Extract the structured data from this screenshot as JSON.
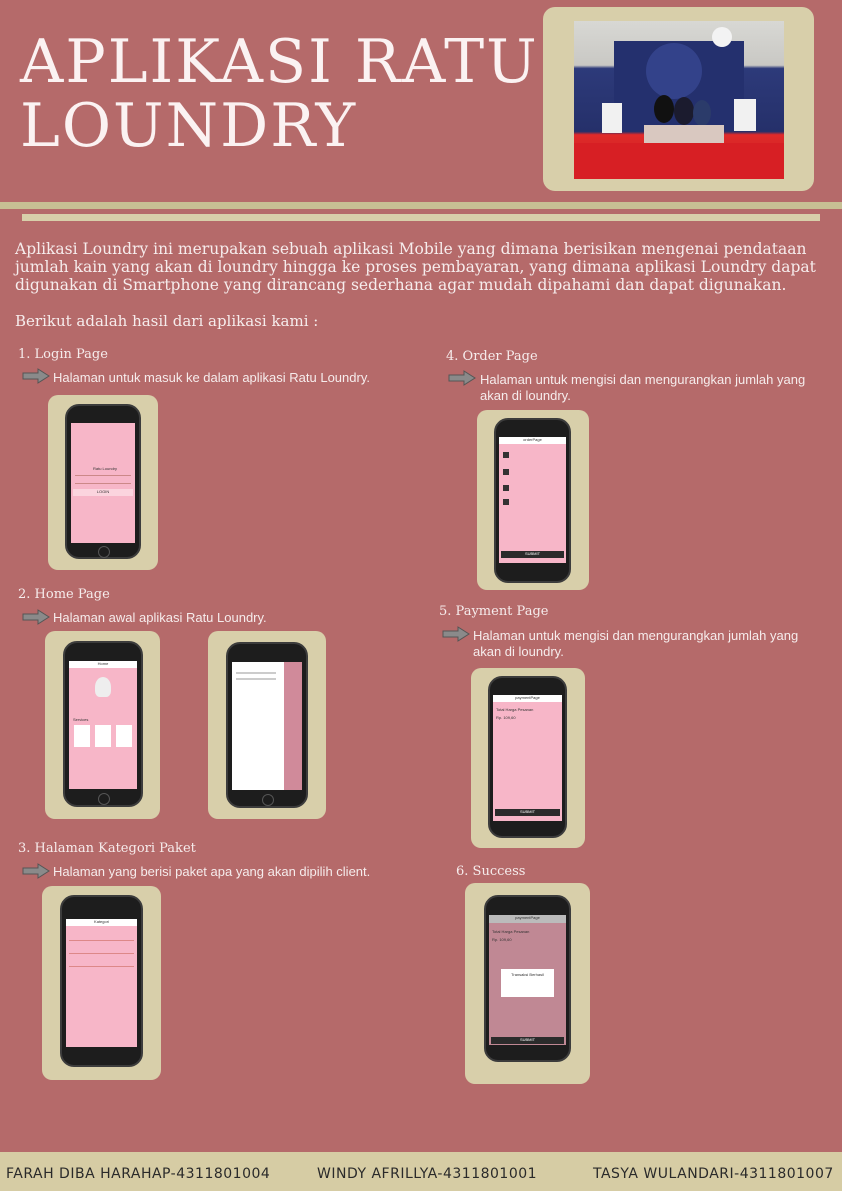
{
  "header": {
    "title_line1": "APLIKASI RATU",
    "title_line2": "LOUNDRY"
  },
  "intro": {
    "paragraph": "Aplikasi Loundry ini merupakan sebuah aplikasi Mobile yang dimana berisikan mengenai pendataan jumlah kain yang akan di loundry hingga ke proses pembayaran, yang dimana aplikasi Loundry dapat digunakan di Smartphone yang dirancang sederhana agar mudah dipahami dan dapat digunakan.",
    "lead": "Berikut adalah hasil dari aplikasi kami :"
  },
  "sections": {
    "login": {
      "title": "1. Login Page",
      "desc": "Halaman untuk masuk ke dalam aplikasi Ratu Loundry."
    },
    "home": {
      "title": "2. Home Page",
      "desc": "Halaman awal aplikasi Ratu Loundry."
    },
    "kategori": {
      "title": "3. Halaman Kategori Paket",
      "desc": "Halaman yang berisi paket apa yang akan dipilih client."
    },
    "order": {
      "title": "4. Order Page",
      "desc": "Halaman untuk mengisi dan mengurangkan jumlah yang akan di loundry."
    },
    "payment": {
      "title": "5. Payment Page",
      "desc": "Halaman untuk mengisi dan mengurangkan jumlah yang akan di loundry."
    },
    "success": {
      "title": "6. Success"
    }
  },
  "screens": {
    "login_app": "Ratu Loundry",
    "login_button": "LOGIN",
    "home_title": "Home",
    "home_services": "Services",
    "order_title": "orderPage",
    "order_submit": "SUBMIT",
    "payment_title": "paymentPage",
    "payment_total": "Total Harga Pesanan",
    "payment_amount": "Rp. 109,60",
    "payment_submit": "SUBMIT",
    "success_title": "paymentPage",
    "success_total": "Total Harga Pesanan",
    "success_amount": "Rp. 109,60",
    "success_dialog": "Transaksi Berhasil",
    "success_submit": "SUBMIT",
    "kategori_title": "Kategori"
  },
  "footer": {
    "member1": "FARAH DIBA HARAHAP-4311801004",
    "member2": "WINDY AFRILLYA-4311801001",
    "member3": "TASYA WULANDARI-4311801007"
  },
  "colors": {
    "background": "#b56a6a",
    "frame": "#d8cfaa",
    "screen": "#f7b6c8"
  }
}
